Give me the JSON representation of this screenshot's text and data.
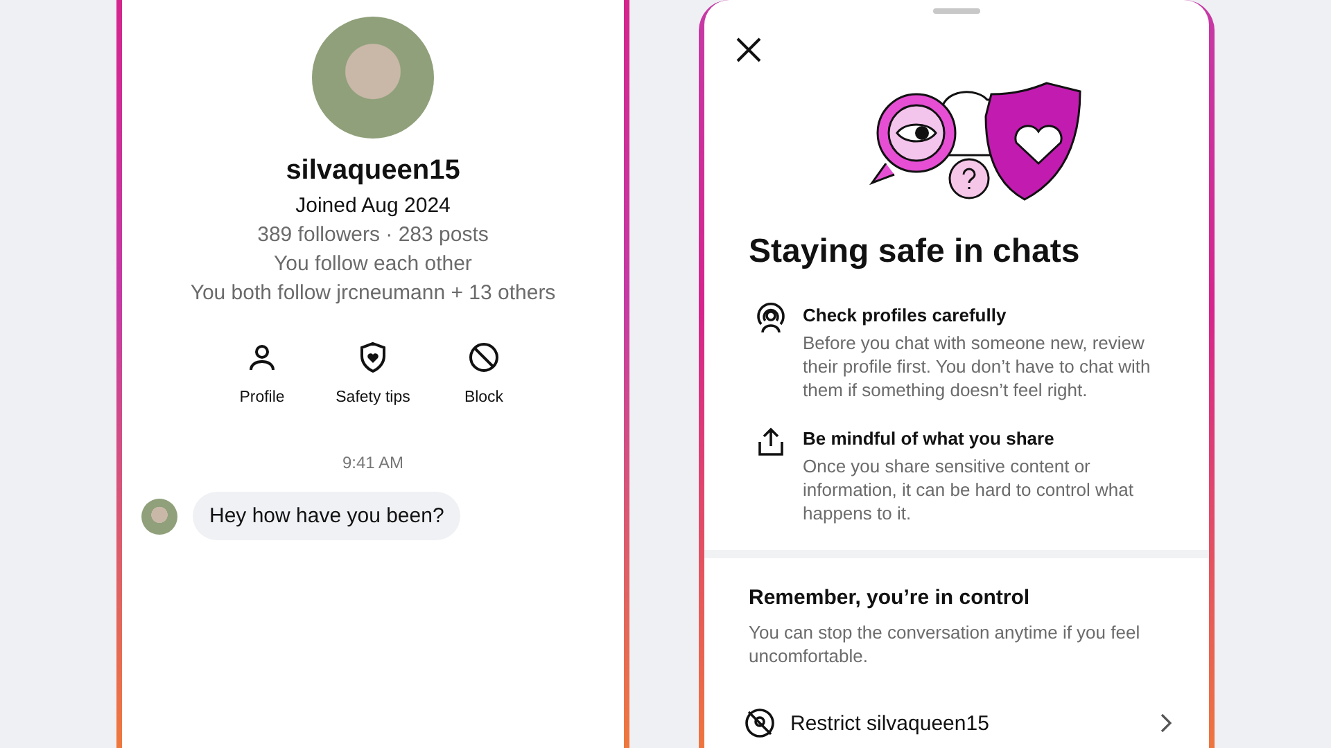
{
  "profile": {
    "username": "silvaqueen15",
    "joined": "Joined Aug 2024",
    "stats": "389 followers · 283 posts",
    "relation": "You follow each other",
    "mutual": "You both follow jrcneumann + 13 others"
  },
  "actions": [
    {
      "kind": "profile",
      "label": "Profile"
    },
    {
      "kind": "safety",
      "label": "Safety tips"
    },
    {
      "kind": "block",
      "label": "Block"
    }
  ],
  "chat": {
    "time": "9:41 AM",
    "messages": [
      {
        "text": "Hey how have you been?"
      }
    ]
  },
  "sheet": {
    "title": "Staying safe in chats",
    "tips": [
      {
        "kind": "profile",
        "title": "Check profiles carefully",
        "body": "Before you chat with someone new, review their profile first. You don’t have to chat with them if something doesn’t feel right."
      },
      {
        "kind": "share",
        "title": "Be mindful of what you share",
        "body": "Once you share sensitive content or information, it can be hard to control what happens to it."
      }
    ],
    "control": {
      "title": "Remember, you’re in control",
      "body": "You can stop the conversation anytime if you feel uncomfortable."
    },
    "options": [
      {
        "kind": "restrict",
        "label": "Restrict silvaqueen15"
      }
    ]
  }
}
